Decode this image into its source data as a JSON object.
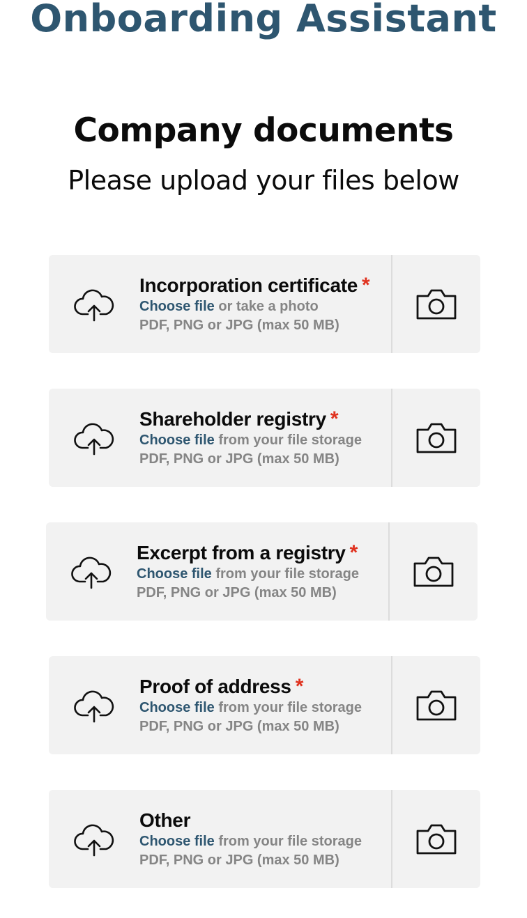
{
  "header": {
    "title": "Onboarding Assistant"
  },
  "section": {
    "title": "Company documents",
    "subtitle": "Please upload your files below"
  },
  "required_marker": "*",
  "documents": [
    {
      "title": "Incorporation certificate",
      "required": true,
      "choose_label": "Choose file",
      "source_text": " or take a photo",
      "formats": "PDF, PNG or JPG (max 50 MB)"
    },
    {
      "title": "Shareholder registry",
      "required": true,
      "choose_label": "Choose file",
      "source_text": " from your file storage",
      "formats": "PDF, PNG or JPG (max 50 MB)"
    },
    {
      "title": "Excerpt from a registry",
      "required": true,
      "choose_label": "Choose file",
      "source_text": " from your file storage",
      "formats": "PDF, PNG or JPG (max 50 MB)"
    },
    {
      "title": "Proof of address",
      "required": true,
      "choose_label": "Choose file",
      "source_text": " from your file storage",
      "formats": "PDF, PNG or JPG (max 50 MB)"
    },
    {
      "title": "Other",
      "required": false,
      "choose_label": "Choose file",
      "source_text": " from your file storage",
      "formats": "PDF, PNG or JPG (max 50 MB)"
    }
  ],
  "icons": {
    "upload": "cloud-upload-icon",
    "camera": "camera-icon"
  },
  "colors": {
    "brand": "#2e5670",
    "required": "#e0321f",
    "muted": "#858585",
    "card_bg": "#f2f2f2"
  }
}
